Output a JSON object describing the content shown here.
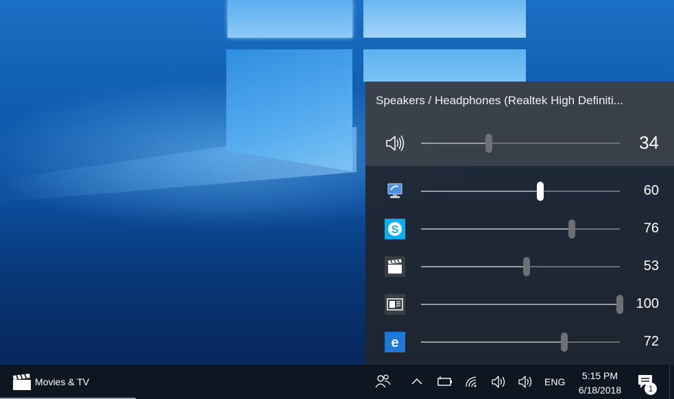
{
  "mixer": {
    "device_name": "Speakers / Headphones (Realtek High Definiti...",
    "master": {
      "icon": "speaker-volume-icon",
      "value": "34",
      "level": 34
    },
    "apps": [
      {
        "name": "system-sounds",
        "icon": "system-sounds-icon",
        "value": "60",
        "level": 60,
        "active": true
      },
      {
        "name": "skype",
        "icon": "skype-icon",
        "value": "76",
        "level": 76,
        "active": false
      },
      {
        "name": "movies-tv",
        "icon": "movies-tv-icon",
        "value": "53",
        "level": 53,
        "active": false
      },
      {
        "name": "media-app",
        "icon": "media-window-icon",
        "value": "100",
        "level": 100,
        "active": false
      },
      {
        "name": "edge",
        "icon": "edge-icon",
        "value": "72",
        "level": 72,
        "active": false
      }
    ]
  },
  "taskbar": {
    "app_label": "Movies & TV",
    "app_icon": "movies-tv-icon",
    "tray_icons": [
      "people-icon",
      "chevron-up-icon",
      "battery-icon",
      "wifi-icon",
      "volume-icon",
      "volume-icon"
    ],
    "language": "ENG",
    "time": "5:15 PM",
    "date": "6/18/2018",
    "notification_count": "1"
  },
  "colors": {
    "flyout_bg": "#20262e",
    "taskbar_bg": "#0e1622",
    "skype_blue": "#00aff0",
    "edge_blue": "#1e78d6"
  }
}
